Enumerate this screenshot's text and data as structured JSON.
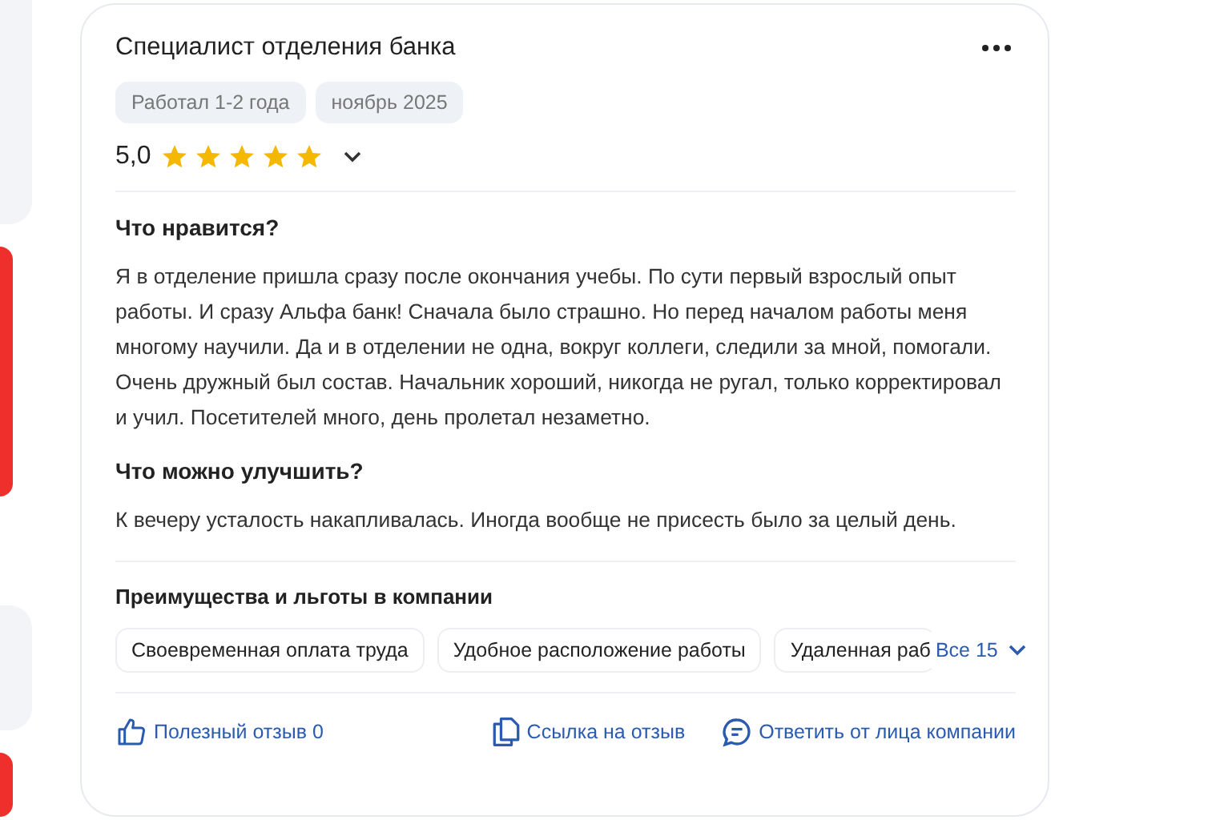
{
  "review": {
    "title": "Специалист отделения банка",
    "tags": [
      "Работал 1-2 года",
      "ноябрь 2025"
    ],
    "rating": "5,0",
    "stars": 5,
    "sections": [
      {
        "heading": "Что нравится?",
        "text": "Я в отделение пришла сразу после окончания учебы. По сути первый взрослый опыт работы. И сразу Альфа банк! Сначала было страшно. Но перед началом работы меня многому научили. Да и в отделении не одна, вокруг коллеги, следили за мной, помогали. Очень дружный был состав. Начальник хороший, никогда не ругал, только корректировал и учил. Посетителей много, день пролетал незаметно."
      },
      {
        "heading": "Что можно улучшить?",
        "text": "К вечеру усталость накапливалась. Иногда вообще не присесть было за целый день."
      }
    ],
    "benefits": {
      "heading": "Преимущества и льготы в компании",
      "items": [
        "Своевременная оплата труда",
        "Удобное расположение работы",
        "Удаленная раб"
      ],
      "more": "Все 15"
    },
    "actions": [
      {
        "kind": "like",
        "label": "Полезный отзыв 0"
      },
      {
        "kind": "link",
        "label": "Ссылка на отзыв"
      },
      {
        "kind": "reply",
        "label": "Ответить от лица компании"
      }
    ]
  }
}
